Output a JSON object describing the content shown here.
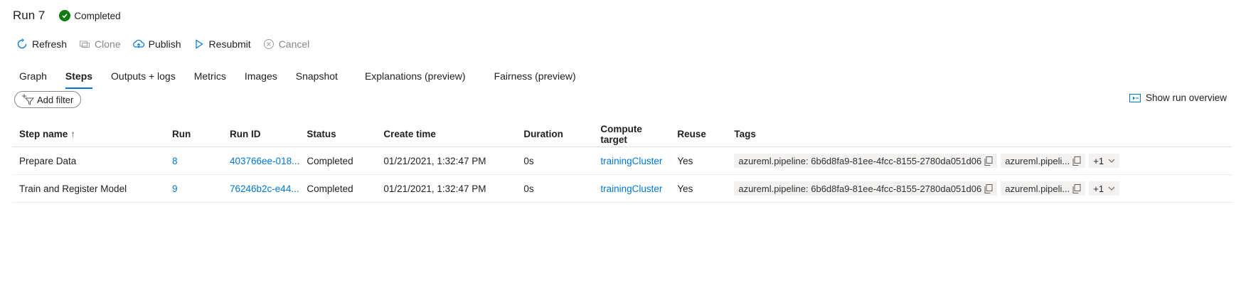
{
  "header": {
    "title": "Run 7",
    "status": "Completed"
  },
  "toolbar": {
    "refresh": "Refresh",
    "clone": "Clone",
    "publish": "Publish",
    "resubmit": "Resubmit",
    "cancel": "Cancel"
  },
  "tabs": [
    "Graph",
    "Steps",
    "Outputs + logs",
    "Metrics",
    "Images",
    "Snapshot",
    "Explanations (preview)",
    "Fairness (preview)"
  ],
  "active_tab": "Steps",
  "filter": {
    "label": "Add filter"
  },
  "overview": {
    "label": "Show run overview"
  },
  "table": {
    "columns": [
      "Step name",
      "Run",
      "Run ID",
      "Status",
      "Create time",
      "Duration",
      "Compute target",
      "Reuse",
      "Tags"
    ],
    "rows": [
      {
        "step_name": "Prepare Data",
        "run": "8",
        "run_id": "403766ee-018...",
        "status": "Completed",
        "create_time": "01/21/2021, 1:32:47 PM",
        "duration": "0s",
        "compute_target": "trainingCluster",
        "reuse": "Yes",
        "tag1": "azureml.pipeline: 6b6d8fa9-81ee-4fcc-8155-2780da051d06",
        "tag2": "azureml.pipeli...",
        "more": "+1"
      },
      {
        "step_name": "Train and Register Model",
        "run": "9",
        "run_id": "76246b2c-e44...",
        "status": "Completed",
        "create_time": "01/21/2021, 1:32:47 PM",
        "duration": "0s",
        "compute_target": "trainingCluster",
        "reuse": "Yes",
        "tag1": "azureml.pipeline: 6b6d8fa9-81ee-4fcc-8155-2780da051d06",
        "tag2": "azureml.pipeli...",
        "more": "+1"
      }
    ]
  },
  "colors": {
    "accent": "#0078d4",
    "success": "#107c10",
    "text": "#201f1e",
    "tag_bg": "#f3f2f1"
  },
  "icons": [
    "refresh-icon",
    "clone-icon",
    "publish-icon",
    "resubmit-icon",
    "cancel-icon",
    "check-icon",
    "filter-icon",
    "overview-icon",
    "copy-icon",
    "chevron-down-icon",
    "sort-up-icon"
  ]
}
